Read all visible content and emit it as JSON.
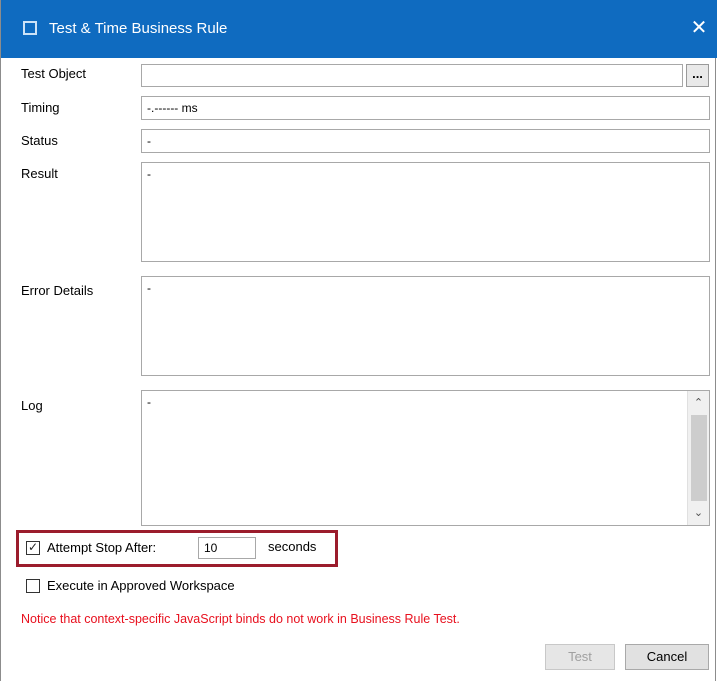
{
  "window": {
    "title": "Test & Time Business Rule",
    "close_glyph": "✕",
    "title_icon": "window-icon"
  },
  "fields": {
    "test_object": {
      "label": "Test Object",
      "value": "",
      "browse_label": "..."
    },
    "timing": {
      "label": "Timing",
      "value": "-.------ ms"
    },
    "status": {
      "label": "Status",
      "value": "-"
    },
    "result": {
      "label": "Result",
      "value": "-"
    },
    "error_details": {
      "label": "Error Details",
      "value": "-"
    },
    "log": {
      "label": "Log",
      "value": "-"
    }
  },
  "scrollbar": {
    "up_glyph": "⌃",
    "down_glyph": "⌄"
  },
  "options": {
    "attempt_stop": {
      "label": "Attempt Stop After:",
      "checked": true,
      "value": "10",
      "unit": "seconds",
      "check_glyph": "✓"
    },
    "approved_workspace": {
      "label": "Execute in Approved Workspace",
      "checked": false
    }
  },
  "notice": "Notice that context-specific JavaScript binds do not work in Business Rule Test.",
  "buttons": {
    "test": "Test",
    "cancel": "Cancel"
  },
  "colors": {
    "titlebar": "#0f6bc0",
    "notice": "#e8101e",
    "highlight": "#9b1c2c"
  }
}
